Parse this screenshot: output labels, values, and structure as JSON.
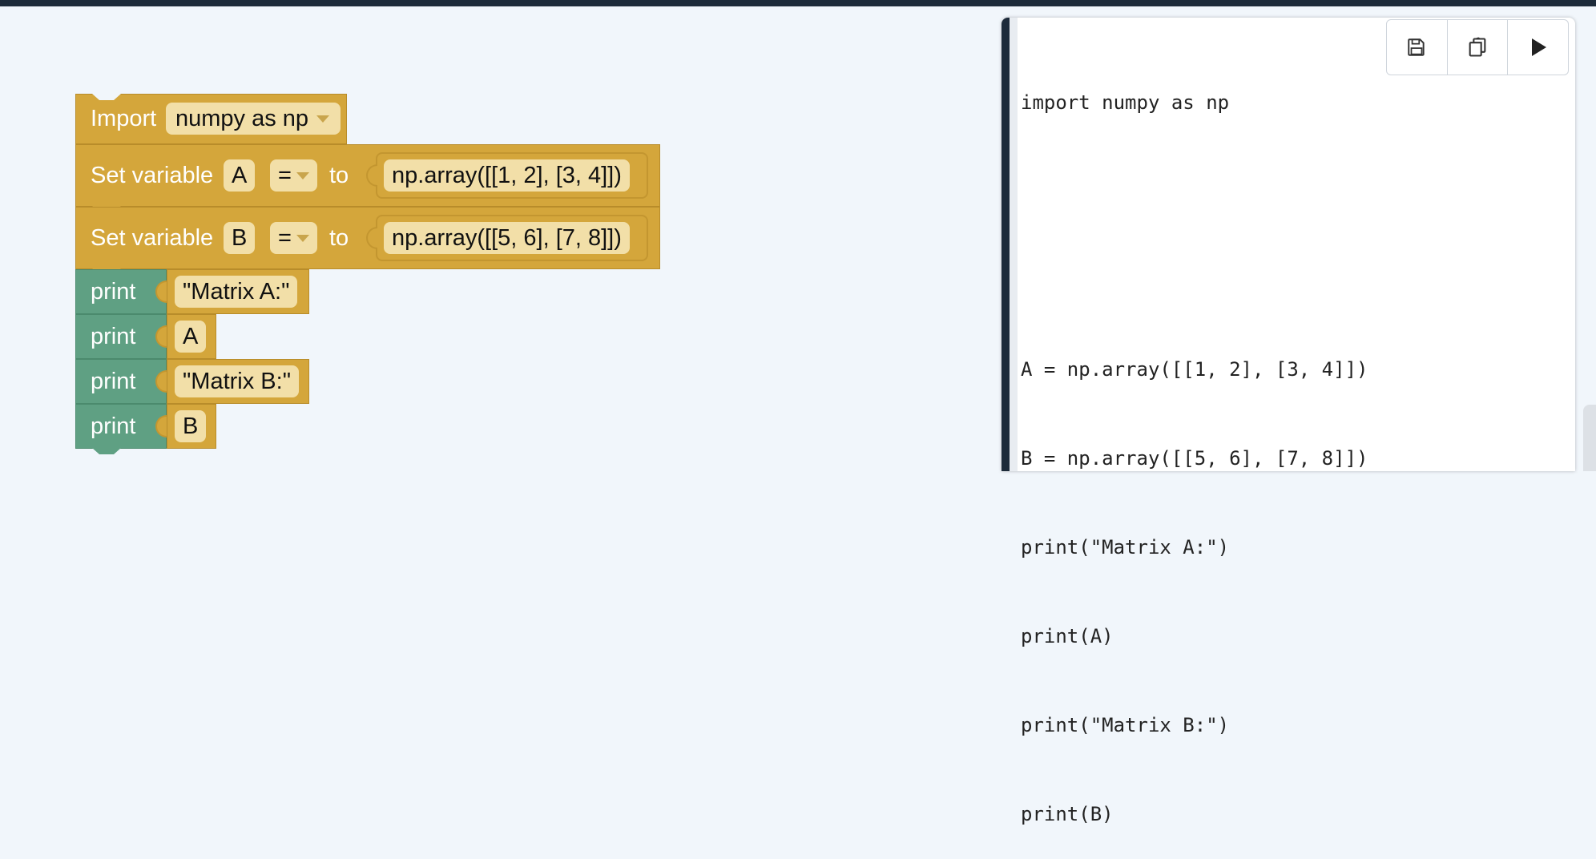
{
  "blocks": {
    "import": {
      "keyword": "Import",
      "module": "numpy as np"
    },
    "set_a": {
      "keyword": "Set variable",
      "name": "A",
      "op": "=",
      "to": "to",
      "value": "np.array([[1, 2], [3, 4]])"
    },
    "set_b": {
      "keyword": "Set variable",
      "name": "B",
      "op": "=",
      "to": "to",
      "value": "np.array([[5, 6], [7, 8]])"
    },
    "prints": [
      {
        "keyword": "print",
        "arg": "\"Matrix A:\""
      },
      {
        "keyword": "print",
        "arg": "A"
      },
      {
        "keyword": "print",
        "arg": "\"Matrix B:\""
      },
      {
        "keyword": "print",
        "arg": "B"
      }
    ]
  },
  "code_panel": {
    "lines": [
      "import numpy as np",
      "",
      "",
      "A = np.array([[1, 2], [3, 4]])",
      "B = np.array([[5, 6], [7, 8]])",
      "print(\"Matrix A:\")",
      "print(A)",
      "print(\"Matrix B:\")",
      "print(B)"
    ],
    "toolbar": [
      "save-icon",
      "copy-icon",
      "run-icon"
    ]
  },
  "colors": {
    "gold": "#d4a63b",
    "teal": "#5fa083",
    "pill": "#f2dfa8",
    "background": "#f1f6fb",
    "dark": "#1d2b3a"
  }
}
